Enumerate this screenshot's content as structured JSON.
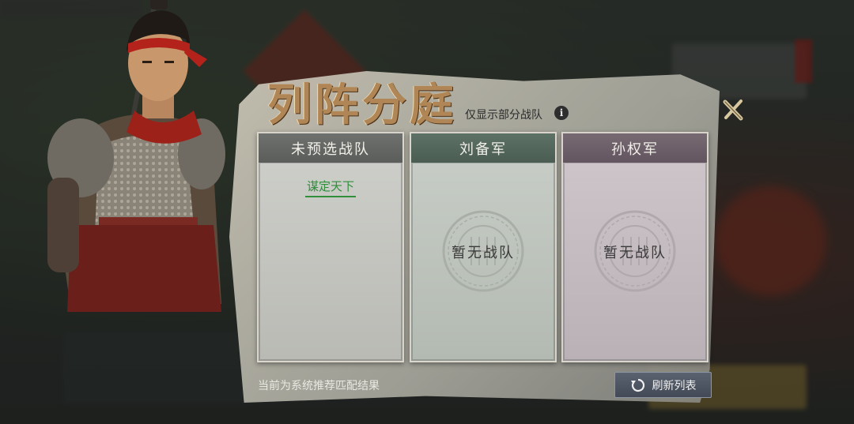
{
  "dialog": {
    "title": "列阵分庭",
    "subtitle": "仅显示部分战队",
    "info_glyph": "i",
    "close_icon": "close-icon"
  },
  "columns": [
    {
      "header": "未预选战队",
      "teams": [
        "谋定天下"
      ],
      "empty_text": ""
    },
    {
      "header": "刘备军",
      "teams": [],
      "empty_text": "暂无战队"
    },
    {
      "header": "孙权军",
      "teams": [],
      "empty_text": "暂无战队"
    }
  ],
  "footer": {
    "status_text": "当前为系统推荐匹配结果",
    "refresh_label": "刷新列表",
    "refresh_icon": "refresh-icon"
  },
  "colors": {
    "title": "#b08656",
    "team_link": "#2f8f3a",
    "col1_header": "#5b5d5b",
    "col2_header": "#4b5d53",
    "col3_header": "#625560"
  }
}
